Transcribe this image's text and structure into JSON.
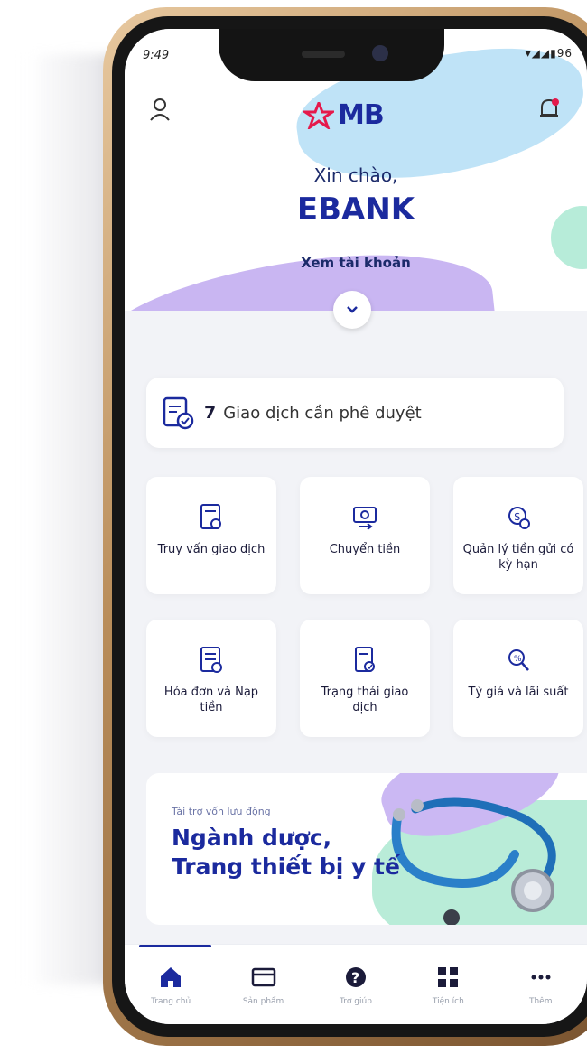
{
  "status_bar": {
    "time": "9:49",
    "icons": "▾◢◢▮96"
  },
  "header": {
    "brand": "MB",
    "greeting": "Xin chào,",
    "user_name": "EBANK",
    "view_account": "Xem tài khoản"
  },
  "pending": {
    "count": "7",
    "label": "Giao dịch cần phê duyệt"
  },
  "services": [
    {
      "label": "Truy vấn giao dịch",
      "icon": "document-search-icon"
    },
    {
      "label": "Chuyển tiền",
      "icon": "money-transfer-icon"
    },
    {
      "label": "Quản lý tiền gửi có kỳ hạn",
      "icon": "deposit-icon"
    },
    {
      "label": "Hóa đơn và Nạp tiền",
      "icon": "bill-icon"
    },
    {
      "label": "Trạng thái giao dịch",
      "icon": "transaction-status-icon"
    },
    {
      "label": "Tỷ giá và lãi suất",
      "icon": "exchange-rate-icon"
    }
  ],
  "banner": {
    "tag": "Tài trợ vốn lưu động",
    "title_line1": "Ngành dược,",
    "title_line2": "Trang thiết bị y tế"
  },
  "tabs": [
    {
      "label": "Trang chủ",
      "icon": "home-icon"
    },
    {
      "label": "Sản phẩm",
      "icon": "card-icon"
    },
    {
      "label": "Trợ giúp",
      "icon": "help-icon"
    },
    {
      "label": "Tiện ích",
      "icon": "grid-icon"
    },
    {
      "label": "Thêm",
      "icon": "more-icon"
    }
  ],
  "colors": {
    "brand": "#1b2a9e",
    "accent_purple": "#c9b6f2",
    "accent_blue": "#bfe3f7",
    "accent_green": "#b9ecd8"
  }
}
